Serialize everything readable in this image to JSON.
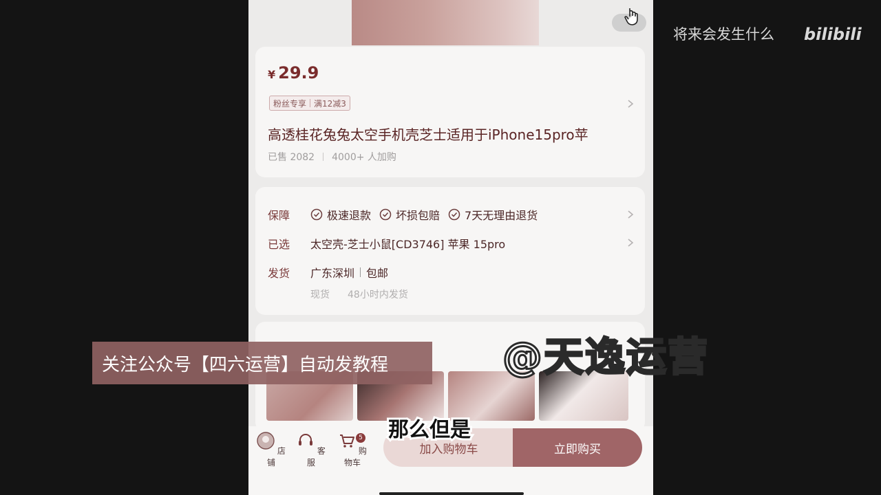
{
  "channel": {
    "title": "将来会发生什么",
    "logo_text": "bilibili"
  },
  "product": {
    "currency": "¥",
    "price": "29.9",
    "tag_fans": "粉丝专享",
    "tag_discount": "满12减3",
    "title": "高透桂花兔兔太空手机壳芝士适用于iPhone15pro苹",
    "sold": "已售 2082",
    "added": "4000+ 人加购"
  },
  "service": {
    "guarantee_label": "保障",
    "guarantees": [
      "极速退款",
      "坏损包赔",
      "7天无理由退货"
    ],
    "selected_label": "已选",
    "selected_value": "太空壳-芝士小鼠[CD3746] 苹果 15pro",
    "ship_label": "发货",
    "ship_from": "广东深圳",
    "ship_fee": "包邮",
    "stock": "现货",
    "ship_time": "48小时内发货"
  },
  "bottom_bar": {
    "shop": "店铺",
    "service": "客服",
    "cart": "购物车",
    "cart_badge": "5",
    "add_to_cart": "加入购物车",
    "buy_now": "立即购买"
  },
  "overlays": {
    "promo": "关注公众号【四六运营】自动发教程",
    "watermark": "@天逸运营",
    "subtitle": "那么但是"
  },
  "colors": {
    "accent": "#a06567",
    "price": "#7a2c2c",
    "promo_bg": "#8f6262"
  }
}
